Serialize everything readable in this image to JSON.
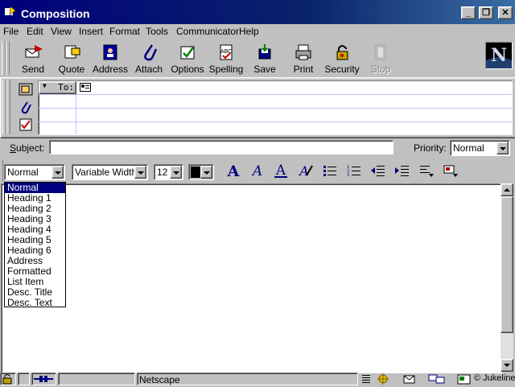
{
  "window": {
    "title": "Composition"
  },
  "menu": [
    "File",
    "Edit",
    "View",
    "Insert",
    "Format",
    "Tools",
    "Communicator",
    "Help"
  ],
  "toolbar": [
    {
      "label": "Send",
      "icon": "send-icon"
    },
    {
      "label": "Quote",
      "icon": "quote-icon"
    },
    {
      "label": "Address",
      "icon": "address-book-icon"
    },
    {
      "label": "Attach",
      "icon": "paperclip-icon"
    },
    {
      "label": "Options",
      "icon": "options-icon"
    },
    {
      "label": "Spelling",
      "icon": "spelling-icon"
    },
    {
      "label": "Save",
      "icon": "save-icon"
    },
    {
      "label": "Print",
      "icon": "printer-icon"
    },
    {
      "label": "Security",
      "icon": "padlock-icon"
    },
    {
      "label": "Stop",
      "icon": "stop-icon"
    }
  ],
  "addressing": {
    "to_label": "To:"
  },
  "subject": {
    "label": "Subject:",
    "value": ""
  },
  "priority": {
    "label": "Priority:",
    "value": "Normal"
  },
  "format": {
    "paragraph": "Normal",
    "font": "Variable Width",
    "size": "12",
    "color": "#000000"
  },
  "paragraph_options": [
    "Normal",
    "Heading 1",
    "Heading 2",
    "Heading 3",
    "Heading 4",
    "Heading 5",
    "Heading 6",
    "Address",
    "Formatted",
    "List Item",
    "Desc. Title",
    "Desc. Text"
  ],
  "status": {
    "text": "Netscape",
    "watermark": "© Jukeline"
  }
}
